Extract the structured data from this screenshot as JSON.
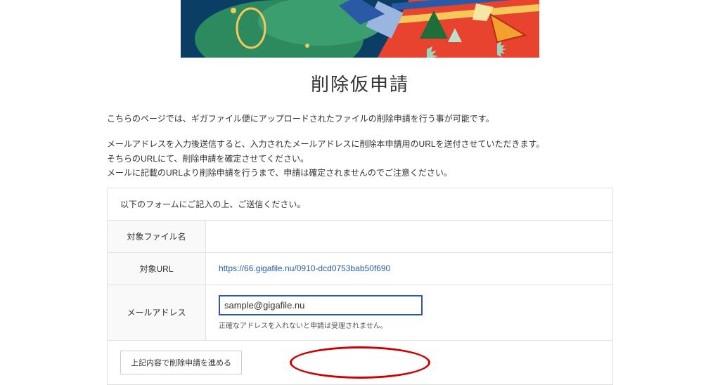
{
  "page": {
    "title": "削除仮申請",
    "intro_paragraph_1": "こちらのページでは、ギガファイル便にアップロードされたファイルの削除申請を行う事が可能です。",
    "intro_paragraph_2_line1": "メールアドレスを入力後送信すると、入力されたメールアドレスに削除本申請用のURLを送付させていただきます。",
    "intro_paragraph_2_line2": "そちらのURLにて、削除申請を確定させてください。",
    "intro_paragraph_2_line3": "メールに記載のURLより削除申請を行うまで、申請は確定されませんのでご注意ください。"
  },
  "form": {
    "caption": "以下のフォームにご記入の上、ご送信ください。",
    "fields": {
      "filename": {
        "label": "対象ファイル名",
        "value": ""
      },
      "url": {
        "label": "対象URL",
        "value": "https://66.gigafile.nu/0910-dcd0753bab50f690"
      },
      "email": {
        "label": "メールアドレス",
        "value": "sample@gigafile.nu",
        "note": "正確なアドレスを入れないと申請は受理されません。"
      }
    },
    "submit_label": "上記内容で削除申請を進める"
  }
}
